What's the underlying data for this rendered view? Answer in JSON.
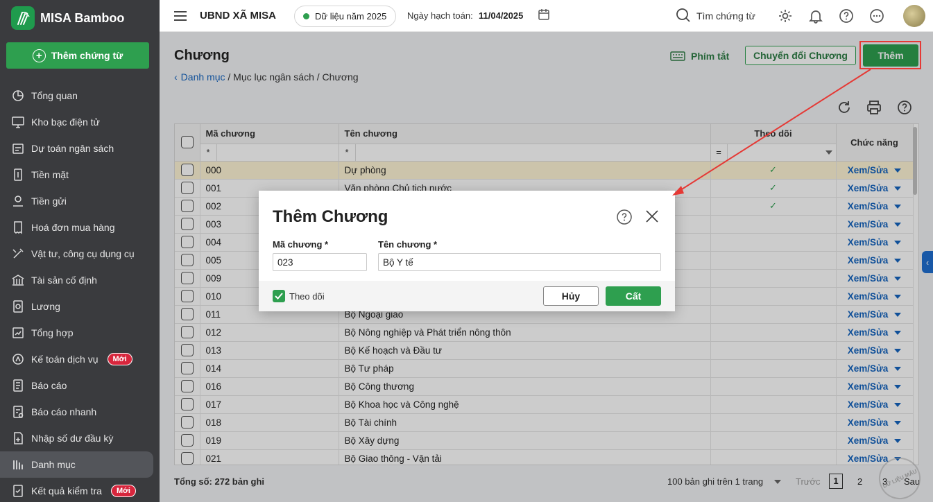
{
  "app": {
    "name": "MISA Bamboo"
  },
  "sidebar": {
    "add_button": "Thêm chứng từ",
    "items": [
      {
        "label": "Tổng quan",
        "icon": "pie-chart-icon"
      },
      {
        "label": "Kho bạc điện tử",
        "icon": "monitor-icon"
      },
      {
        "label": "Dự toán ngân sách",
        "icon": "budget-icon"
      },
      {
        "label": "Tiền mặt",
        "icon": "cash-icon"
      },
      {
        "label": "Tiền gửi",
        "icon": "deposit-icon"
      },
      {
        "label": "Hoá đơn mua hàng",
        "icon": "invoice-icon"
      },
      {
        "label": "Vật tư, công cụ dụng cụ",
        "icon": "tools-icon"
      },
      {
        "label": "Tài sản cố định",
        "icon": "bank-icon"
      },
      {
        "label": "Lương",
        "icon": "salary-icon"
      },
      {
        "label": "Tổng hợp",
        "icon": "summary-icon"
      },
      {
        "label": "Kế toán dịch vụ",
        "icon": "service-icon",
        "badge": "Mới"
      },
      {
        "label": "Báo cáo",
        "icon": "report-icon"
      },
      {
        "label": "Báo cáo nhanh",
        "icon": "quick-report-icon"
      },
      {
        "label": "Nhập số dư đầu kỳ",
        "icon": "opening-balance-icon"
      },
      {
        "label": "Danh mục",
        "icon": "catalog-icon",
        "active": true
      },
      {
        "label": "Kết quả kiểm tra",
        "icon": "check-result-icon",
        "badge": "Mới"
      }
    ]
  },
  "topbar": {
    "org": "UBND XÃ MISA",
    "data_year": "Dữ liệu năm 2025",
    "posting_label": "Ngày hạch toán:",
    "posting_date": "11/04/2025",
    "search_placeholder": "Tìm chứng từ"
  },
  "page": {
    "title": "Chương",
    "breadcrumb": {
      "back": "Danh mục",
      "rest": " / Mục lục ngân sách / Chương"
    },
    "shortcut": "Phím tắt",
    "convert_button": "Chuyển đổi Chương",
    "add_button": "Thêm"
  },
  "table": {
    "headers": {
      "code": "Mã chương",
      "name": "Tên chương",
      "follow": "Theo dõi",
      "action": "Chức năng"
    },
    "filter_star": "*",
    "filter_eq": "=",
    "action_label": "Xem/Sửa",
    "rows": [
      {
        "code": "000",
        "name": "Dự phòng",
        "follow": true
      },
      {
        "code": "001",
        "name": "Văn phòng Chủ tịch nước",
        "follow": true
      },
      {
        "code": "002",
        "name": "",
        "follow": true
      },
      {
        "code": "003",
        "name": "",
        "follow": false
      },
      {
        "code": "004",
        "name": "",
        "follow": false
      },
      {
        "code": "005",
        "name": "",
        "follow": false
      },
      {
        "code": "009",
        "name": "",
        "follow": false
      },
      {
        "code": "010",
        "name": "",
        "follow": false
      },
      {
        "code": "011",
        "name": "Bộ Ngoại giao",
        "follow": false
      },
      {
        "code": "012",
        "name": "Bộ Nông nghiệp và Phát triển nông thôn",
        "follow": false
      },
      {
        "code": "013",
        "name": "Bộ Kế hoạch và Đầu tư",
        "follow": false
      },
      {
        "code": "014",
        "name": "Bộ Tư pháp",
        "follow": false
      },
      {
        "code": "016",
        "name": "Bộ Công thương",
        "follow": false
      },
      {
        "code": "017",
        "name": "Bộ Khoa học và Công nghệ",
        "follow": false
      },
      {
        "code": "018",
        "name": "Bộ Tài chính",
        "follow": false
      },
      {
        "code": "019",
        "name": "Bộ Xây dựng",
        "follow": false
      },
      {
        "code": "021",
        "name": "Bộ Giao thông - Vận tải",
        "follow": false
      }
    ]
  },
  "footer": {
    "total": "Tổng số: 272 bản ghi",
    "page_size": "100 bản ghi trên 1 trang",
    "prev": "Trước",
    "pages": [
      "1",
      "2",
      "3"
    ],
    "next": "Sau",
    "watermark": "DỮ LIỆU MẪU"
  },
  "modal": {
    "title": "Thêm Chương",
    "code_label": "Mã chương *",
    "code_value": "023",
    "name_label": "Tên chương *",
    "name_value": "Bộ Y tế",
    "follow_label": "Theo dõi",
    "cancel": "Hủy",
    "save": "Cất"
  },
  "colors": {
    "accent": "#2e9f4f",
    "sidebar": "#3a3b3e",
    "link": "#1565c0",
    "highlight": "#e53935"
  }
}
